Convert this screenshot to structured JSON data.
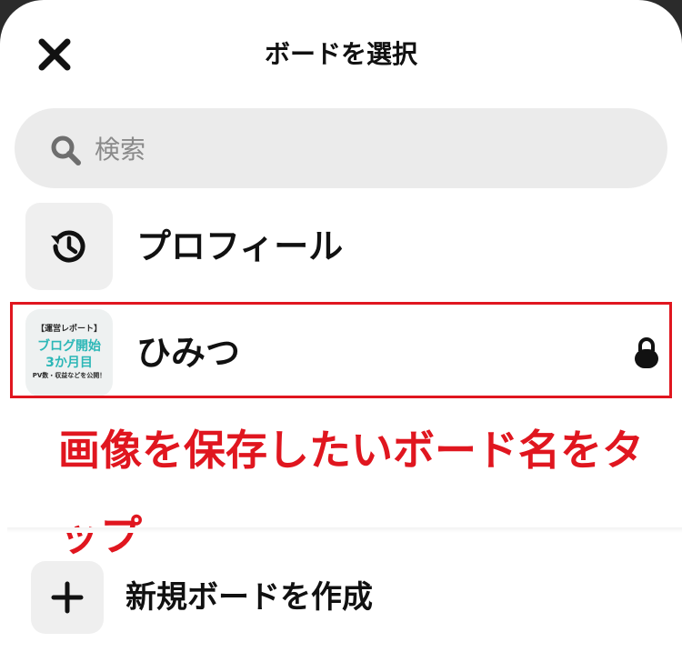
{
  "header": {
    "title": "ボードを選択",
    "close_icon": "close-icon"
  },
  "search": {
    "placeholder": "検索",
    "value": "",
    "icon": "search-icon"
  },
  "boards": [
    {
      "label": "プロフィール",
      "icon": "history-icon",
      "locked": false
    },
    {
      "label": "ひみつ",
      "locked": true,
      "lock_icon": "lock-icon",
      "cover": {
        "line1": "【運営レポート】",
        "line2": "ブログ開始",
        "line3": "3か月目",
        "line4": "PV数・収益などを公開！"
      }
    }
  ],
  "annotation": {
    "text": "画像を保存したいボード名をタップ",
    "color": "#e0161f"
  },
  "create": {
    "label": "新規ボードを作成",
    "icon": "plus-icon"
  },
  "colors": {
    "highlight": "#e0161f",
    "cover_accent": "#2cb7b7",
    "search_bg": "#ebebeb",
    "thumb_bg": "#efefef"
  }
}
